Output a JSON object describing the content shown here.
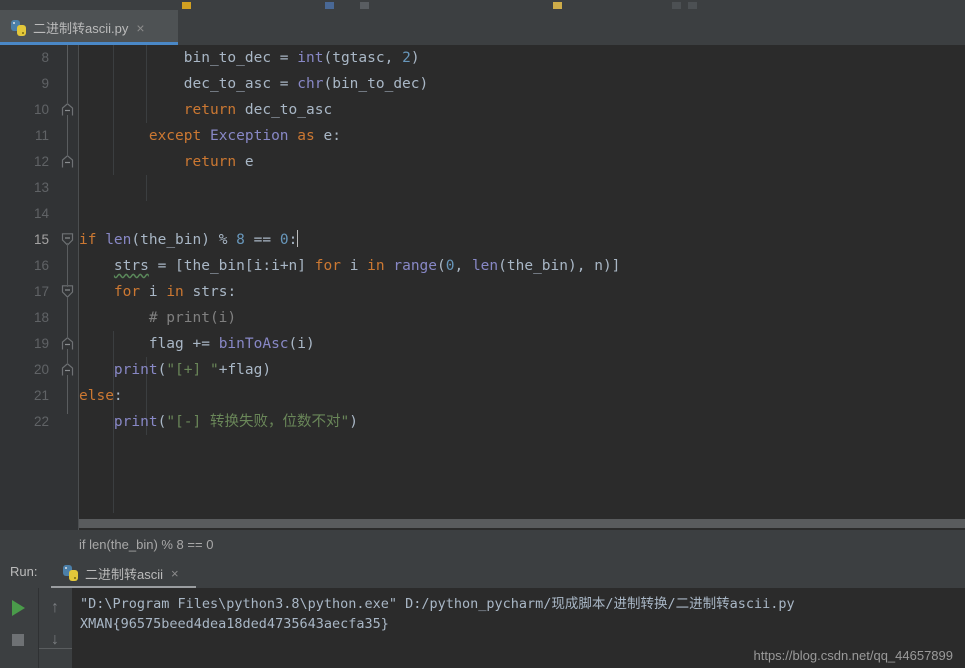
{
  "window": {
    "tab": {
      "label": "二进制转ascii.py",
      "close": "×",
      "icon": "python-file-icon"
    }
  },
  "editor": {
    "lines": [
      {
        "number": "8",
        "fold": "none",
        "text": "            bin_to_dec = int(tgtasc, 2)"
      },
      {
        "number": "9",
        "fold": "none",
        "text": "            dec_to_asc = chr(bin_to_dec)"
      },
      {
        "number": "10",
        "fold": "end",
        "text": "            return dec_to_asc"
      },
      {
        "number": "11",
        "fold": "none",
        "text": "        except Exception as e:"
      },
      {
        "number": "12",
        "fold": "end",
        "text": "            return e"
      },
      {
        "number": "13",
        "fold": "none",
        "text": ""
      },
      {
        "number": "14",
        "fold": "none",
        "text": ""
      },
      {
        "number": "15",
        "fold": "open",
        "text": "if len(the_bin) % 8 == 0:"
      },
      {
        "number": "16",
        "fold": "none",
        "text": "    strs = [the_bin[i:i+n] for i in range(0, len(the_bin), n)]"
      },
      {
        "number": "17",
        "fold": "open",
        "text": "    for i in strs:"
      },
      {
        "number": "18",
        "fold": "none",
        "text": "        # print(i)"
      },
      {
        "number": "19",
        "fold": "end",
        "text": "        flag += binToAsc(i)"
      },
      {
        "number": "20",
        "fold": "end",
        "text": "    print(\"[+] \"+flag)"
      },
      {
        "number": "21",
        "fold": "none",
        "text": "else:"
      },
      {
        "number": "22",
        "fold": "none",
        "text": "    print(\"[-] 转换失败，位数不对\")"
      }
    ],
    "current_line": "15"
  },
  "breadcrumb": {
    "text": "if len(the_bin) % 8 == 0"
  },
  "run_panel": {
    "title": "Run:",
    "tab_label": "二进制转ascii",
    "tab_close": "×",
    "buttons": {
      "run": "run-button",
      "stop": "stop-button",
      "up": "↑",
      "down": "↓"
    },
    "console": [
      "\"D:\\Program Files\\python3.8\\python.exe\" D:/python_pycharm/现成脚本/进制转换/二进制转ascii.py",
      "XMAN{96575beed4dea18ded4735643aecfa35}"
    ]
  },
  "watermark": {
    "text": "https://blog.csdn.net/qq_44657899"
  },
  "colors": {
    "editor_bg": "#2b2b2b",
    "panel_bg": "#3c3f41",
    "gutter_bg": "#313335",
    "keyword": "#cc7832",
    "builtin": "#8888c6",
    "number": "#6897bb",
    "string": "#6a8759",
    "comment": "#808080",
    "text": "#a9b7c6",
    "tab_accent": "#4a88c7",
    "run_green": "#4a9b4a"
  }
}
